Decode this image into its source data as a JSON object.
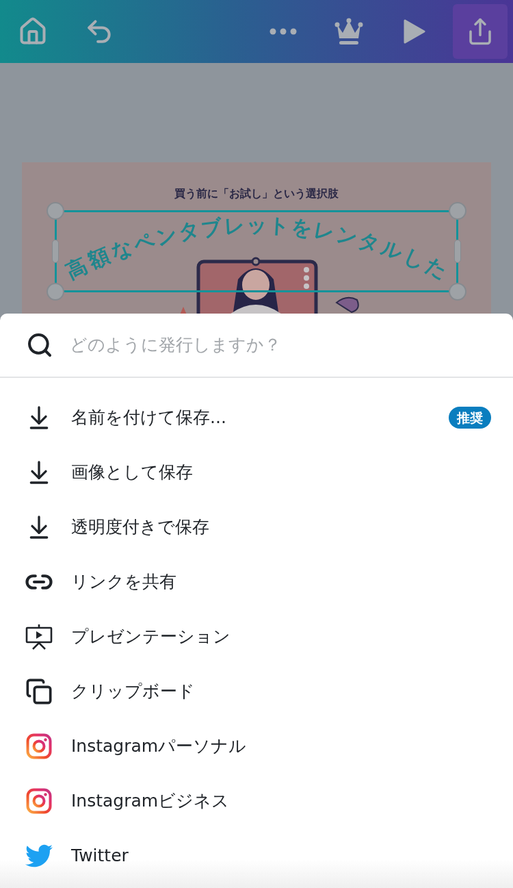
{
  "toolbar": {
    "left": [
      {
        "kind": "home",
        "selected": false
      },
      {
        "kind": "undo",
        "selected": false
      }
    ],
    "right": [
      {
        "kind": "more",
        "selected": false
      },
      {
        "kind": "premium",
        "selected": false
      },
      {
        "kind": "play",
        "selected": false
      },
      {
        "kind": "share",
        "selected": true
      }
    ]
  },
  "design": {
    "subtitle": "買う前に「お試し」という選択肢",
    "title": "高額なペンタブレットをレンタルした"
  },
  "sheet": {
    "search": {
      "placeholder": "どのように発行しますか？"
    },
    "items": [
      {
        "kind": "download",
        "label": "名前を付けて保存...",
        "badge": "推奨"
      },
      {
        "kind": "download",
        "label": "画像として保存"
      },
      {
        "kind": "download",
        "label": "透明度付きで保存"
      },
      {
        "kind": "link",
        "label": "リンクを共有"
      },
      {
        "kind": "presentation",
        "label": "プレゼンテーション"
      },
      {
        "kind": "clipboard",
        "label": "クリップボード"
      },
      {
        "kind": "instagram",
        "label": "Instagramパーソナル"
      },
      {
        "kind": "instagram",
        "label": "Instagramビジネス"
      },
      {
        "kind": "twitter",
        "label": "Twitter"
      }
    ]
  }
}
